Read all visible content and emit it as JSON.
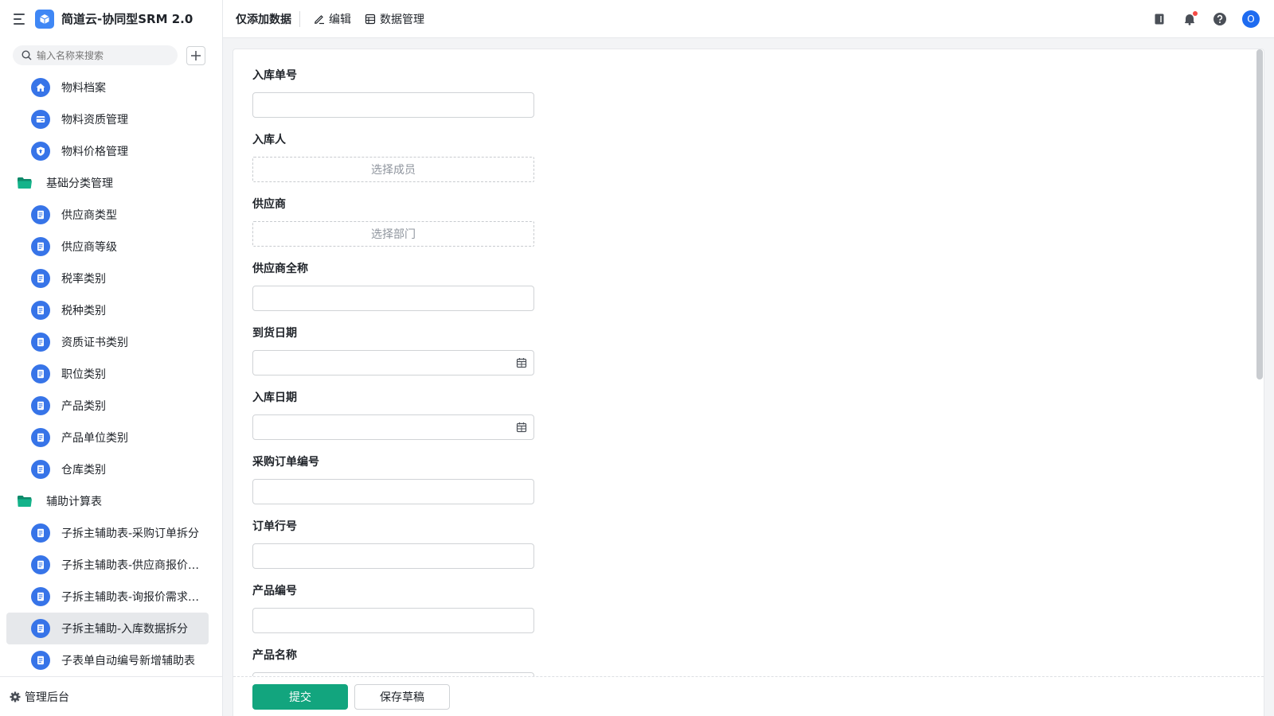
{
  "app": {
    "title": "简道云-协同型SRM 2.0"
  },
  "sidebar": {
    "search_placeholder": "输入名称来搜索",
    "items": [
      {
        "label": "物料档案",
        "kind": "child",
        "icon": "home-icon"
      },
      {
        "label": "物料资质管理",
        "kind": "child",
        "icon": "card-icon"
      },
      {
        "label": "物料价格管理",
        "kind": "child",
        "icon": "shield-up-icon"
      },
      {
        "label": "基础分类管理",
        "kind": "group",
        "icon": "folder-icon"
      },
      {
        "label": "供应商类型",
        "kind": "child",
        "icon": "form-icon"
      },
      {
        "label": "供应商等级",
        "kind": "child",
        "icon": "form-icon"
      },
      {
        "label": "税率类别",
        "kind": "child",
        "icon": "form-icon"
      },
      {
        "label": "税种类别",
        "kind": "child",
        "icon": "form-icon"
      },
      {
        "label": "资质证书类别",
        "kind": "child",
        "icon": "form-icon"
      },
      {
        "label": "职位类别",
        "kind": "child",
        "icon": "form-icon"
      },
      {
        "label": "产品类别",
        "kind": "child",
        "icon": "form-icon"
      },
      {
        "label": "产品单位类别",
        "kind": "child",
        "icon": "form-icon"
      },
      {
        "label": "仓库类别",
        "kind": "child",
        "icon": "form-icon"
      },
      {
        "label": "辅助计算表",
        "kind": "group",
        "icon": "folder-icon"
      },
      {
        "label": "子拆主辅助表-采购订单拆分",
        "kind": "child",
        "icon": "form-icon"
      },
      {
        "label": "子拆主辅助表-供应商报价…",
        "kind": "child",
        "icon": "form-icon"
      },
      {
        "label": "子拆主辅助表-询报价需求…",
        "kind": "child",
        "icon": "form-icon"
      },
      {
        "label": "子拆主辅助-入库数据拆分",
        "kind": "child",
        "icon": "form-icon",
        "active": true
      },
      {
        "label": "子表单自动编号新增辅助表",
        "kind": "child",
        "icon": "form-icon"
      }
    ],
    "footer_label": "管理后台"
  },
  "topbar": {
    "title": "仅添加数据",
    "edit_label": "编辑",
    "data_manage_label": "数据管理",
    "avatar_initial": "O"
  },
  "form": {
    "fields": [
      {
        "label": "入库单号",
        "type": "text"
      },
      {
        "label": "入库人",
        "type": "member",
        "placeholder": "选择成员"
      },
      {
        "label": "供应商",
        "type": "dept",
        "placeholder": "选择部门"
      },
      {
        "label": "供应商全称",
        "type": "text"
      },
      {
        "label": "到货日期",
        "type": "date"
      },
      {
        "label": "入库日期",
        "type": "date"
      },
      {
        "label": "采购订单编号",
        "type": "text"
      },
      {
        "label": "订单行号",
        "type": "text"
      },
      {
        "label": "产品编号",
        "type": "text"
      },
      {
        "label": "产品名称",
        "type": "text"
      }
    ],
    "submit_label": "提交",
    "draft_label": "保存草稿"
  },
  "colors": {
    "primary": "#12a57e",
    "nav_icon": "#3774e8",
    "folder": "#14b38a",
    "brand": "#3f87f5"
  }
}
